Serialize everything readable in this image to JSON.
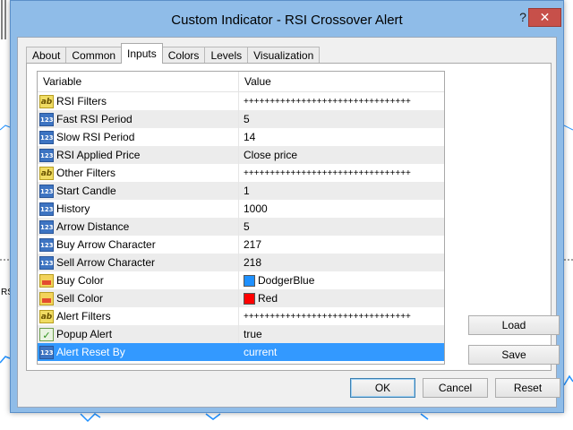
{
  "window": {
    "title": "Custom Indicator - RSI Crossover Alert",
    "help_glyph": "?",
    "close_glyph": "✕"
  },
  "background": {
    "label": "RS"
  },
  "tabs": [
    {
      "label": "About",
      "active": false
    },
    {
      "label": "Common",
      "active": false
    },
    {
      "label": "Inputs",
      "active": true
    },
    {
      "label": "Colors",
      "active": false
    },
    {
      "label": "Levels",
      "active": false
    },
    {
      "label": "Visualization",
      "active": false
    }
  ],
  "grid": {
    "headers": {
      "variable": "Variable",
      "value": "Value"
    },
    "rows": [
      {
        "type": "str",
        "variable": "RSI Filters",
        "value": "++++++++++++++++++++++++++++++++"
      },
      {
        "type": "num",
        "variable": "Fast RSI Period",
        "value": "5"
      },
      {
        "type": "num",
        "variable": "Slow RSI Period",
        "value": "14"
      },
      {
        "type": "num",
        "variable": "RSI Applied Price",
        "value": "Close price"
      },
      {
        "type": "str",
        "variable": "Other Filters",
        "value": "++++++++++++++++++++++++++++++++"
      },
      {
        "type": "num",
        "variable": "Start Candle",
        "value": "1"
      },
      {
        "type": "num",
        "variable": "History",
        "value": "1000"
      },
      {
        "type": "num",
        "variable": "Arrow Distance",
        "value": "5"
      },
      {
        "type": "num",
        "variable": "Buy Arrow Character",
        "value": "217"
      },
      {
        "type": "num",
        "variable": "Sell Arrow Character",
        "value": "218"
      },
      {
        "type": "color",
        "variable": "Buy Color",
        "value": "DodgerBlue",
        "swatch": "#1e90ff"
      },
      {
        "type": "color",
        "variable": "Sell Color",
        "value": "Red",
        "swatch": "#ff0000"
      },
      {
        "type": "str",
        "variable": "Alert Filters",
        "value": "++++++++++++++++++++++++++++++++"
      },
      {
        "type": "bool",
        "variable": "Popup Alert",
        "value": "true"
      },
      {
        "type": "num",
        "variable": "Alert Reset By",
        "value": "current",
        "selected": true
      }
    ]
  },
  "icon_text": {
    "num": "123",
    "str": "ab",
    "bool": "✓"
  },
  "side_buttons": {
    "load": "Load",
    "save": "Save"
  },
  "footer_buttons": {
    "ok": "OK",
    "cancel": "Cancel",
    "reset": "Reset"
  },
  "colors": {
    "selection": "#3399ff",
    "close_button": "#c7504a",
    "frame": "#8fbce8"
  }
}
